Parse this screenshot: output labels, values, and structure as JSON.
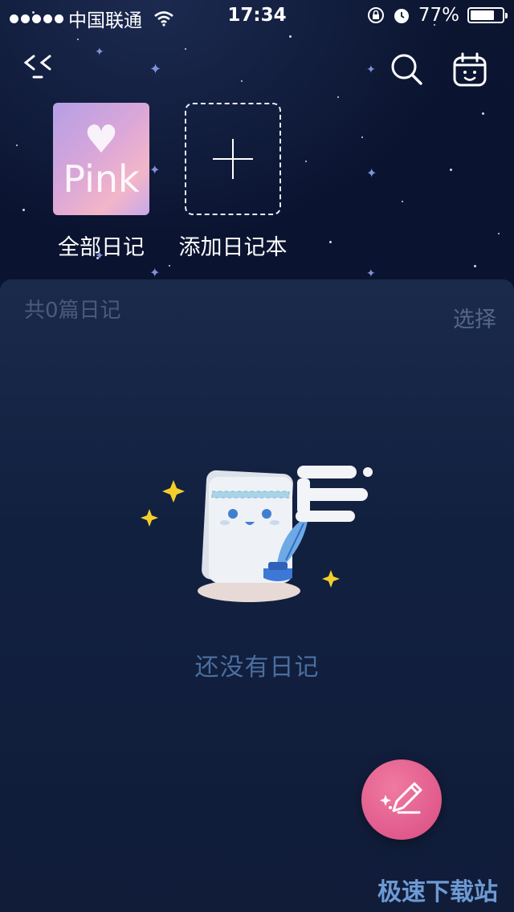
{
  "status_bar": {
    "carrier": "中国联通",
    "time": "17:34",
    "battery_percent": "77%",
    "battery_level": 0.77
  },
  "header": {
    "back_icon": "back-icon",
    "search_icon": "search-icon",
    "calendar_icon": "calendar-face-icon"
  },
  "notebooks": [
    {
      "label": "全部日记",
      "cover_text": "Pink"
    },
    {
      "label": "添加日记本"
    }
  ],
  "main": {
    "count_text": "共0篇日记",
    "select_label": "选择",
    "empty_text": "还没有日记"
  },
  "fab": {
    "icon": "compose-pen-icon"
  },
  "watermark": "极速下载站",
  "colors": {
    "background": "#0c1630",
    "panel": "#122040",
    "fab": "#e05a8c",
    "empty_text": "#4a6e9f",
    "sparkle": "#f4cf2a"
  }
}
